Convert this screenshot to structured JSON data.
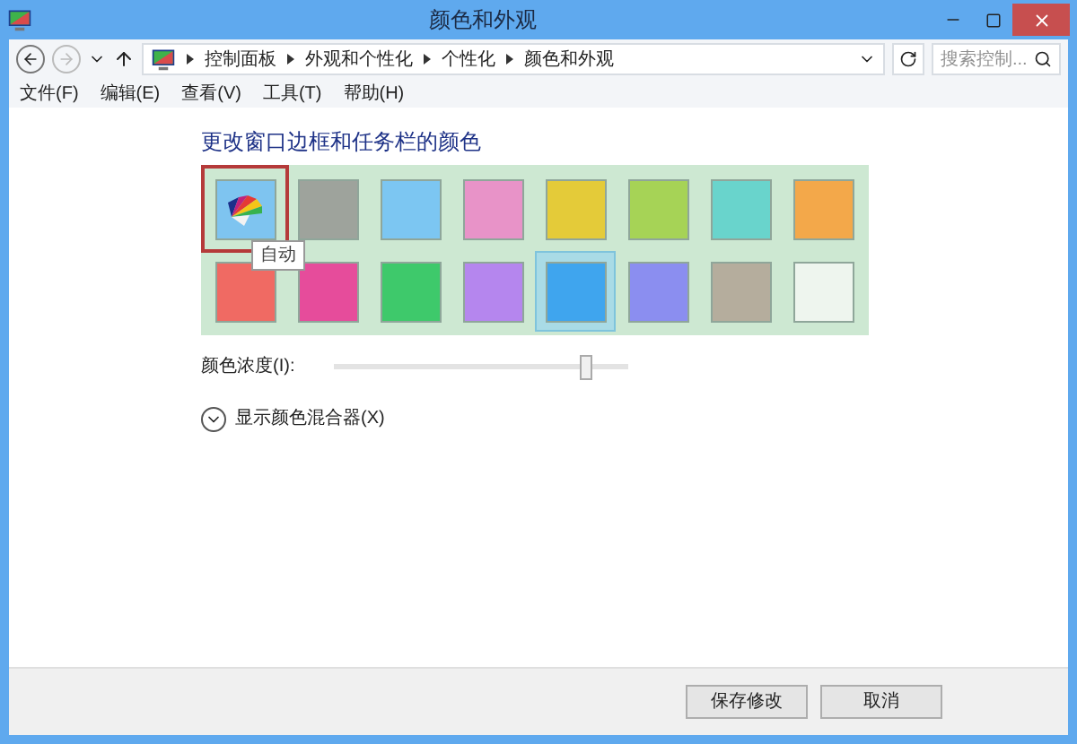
{
  "window": {
    "title": "颜色和外观"
  },
  "address_bar": {
    "path": [
      "控制面板",
      "外观和个性化",
      "个性化",
      "颜色和外观"
    ],
    "search": {
      "placeholder": "搜索控制..."
    }
  },
  "menu": [
    "文件(F)",
    "编辑(E)",
    "查看(V)",
    "工具(T)",
    "帮助(H)"
  ],
  "heading": "更改窗口边框和任务栏的颜色",
  "swatches": [
    {
      "kind": "auto",
      "selected": false,
      "focused": true,
      "tooltip": "自动"
    },
    {
      "kind": "color",
      "color": "#9ea39c",
      "selected": false,
      "focused": false
    },
    {
      "kind": "color",
      "color": "#7cc6f2",
      "selected": false,
      "focused": false
    },
    {
      "kind": "color",
      "color": "#e893c8",
      "selected": false,
      "focused": false
    },
    {
      "kind": "color",
      "color": "#e4cb39",
      "selected": false,
      "focused": false
    },
    {
      "kind": "color",
      "color": "#a6d356",
      "selected": false,
      "focused": false
    },
    {
      "kind": "color",
      "color": "#69d4cc",
      "selected": false,
      "focused": false
    },
    {
      "kind": "color",
      "color": "#f3a84a",
      "selected": false,
      "focused": false
    },
    {
      "kind": "color",
      "color": "#f06a63",
      "selected": false,
      "focused": false
    },
    {
      "kind": "color",
      "color": "#e64c9b",
      "selected": false,
      "focused": false
    },
    {
      "kind": "color",
      "color": "#3ec96b",
      "selected": false,
      "focused": false
    },
    {
      "kind": "color",
      "color": "#b586ee",
      "selected": false,
      "focused": false
    },
    {
      "kind": "color",
      "color": "#3fa5ee",
      "selected": true,
      "focused": false
    },
    {
      "kind": "color",
      "color": "#8b8ef0",
      "selected": false,
      "focused": false
    },
    {
      "kind": "color",
      "color": "#b5ad9d",
      "selected": false,
      "focused": false
    },
    {
      "kind": "color",
      "color": "#eef5ee",
      "selected": false,
      "focused": false
    }
  ],
  "intensity": {
    "label": "颜色浓度(I):",
    "level": 0.86
  },
  "mixer": {
    "label": "显示颜色混合器(X)",
    "expanded": false
  },
  "buttons": [
    "保存修改",
    "取消"
  ]
}
